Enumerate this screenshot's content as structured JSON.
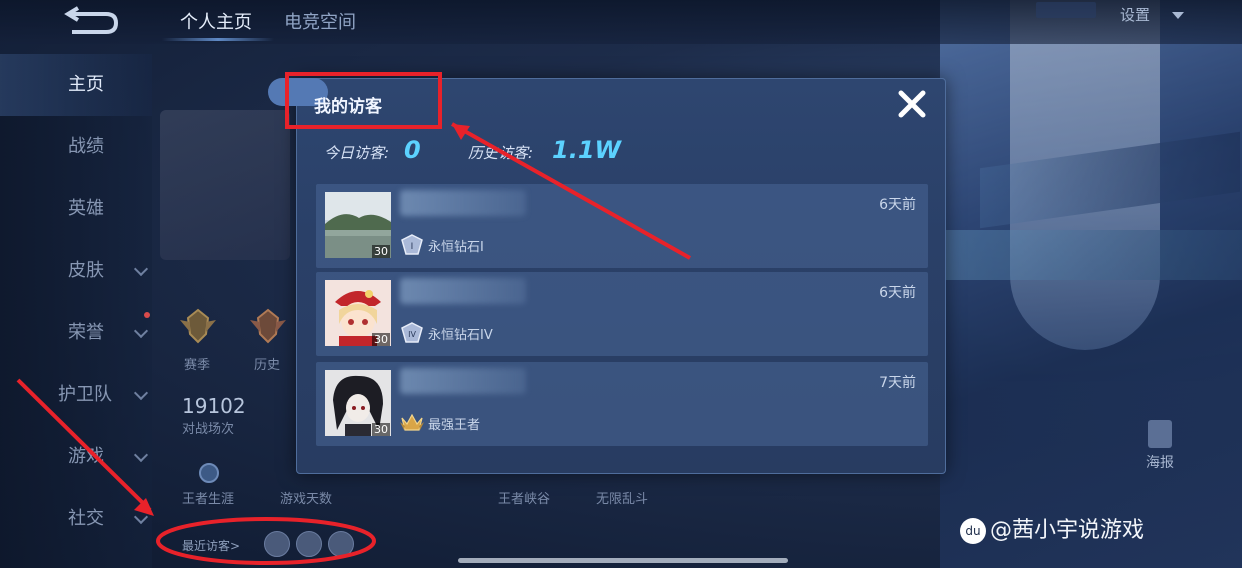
{
  "topbar": {
    "tabs": [
      {
        "label": "个人主页",
        "active": true
      },
      {
        "label": "电竞空间",
        "active": false
      }
    ],
    "settings_label": "设置"
  },
  "sidebar": {
    "items": [
      {
        "label": "主页",
        "active": true,
        "chevron": false
      },
      {
        "label": "战绩",
        "active": false,
        "chevron": false
      },
      {
        "label": "英雄",
        "active": false,
        "chevron": false
      },
      {
        "label": "皮肤",
        "active": false,
        "chevron": true
      },
      {
        "label": "荣誉",
        "active": false,
        "chevron": true
      },
      {
        "label": "护卫队",
        "active": false,
        "chevron": true
      },
      {
        "label": "游戏",
        "active": false,
        "chevron": true
      },
      {
        "label": "社交",
        "active": false,
        "chevron": true
      }
    ]
  },
  "profile": {
    "medal_labels": [
      "赛季",
      "历史"
    ],
    "stats": [
      {
        "value": "19102",
        "label": "对战场次"
      },
      {
        "value": "",
        "label": "王者生涯"
      },
      {
        "value": "",
        "label": "游戏天数"
      },
      {
        "value": "",
        "label": "王者峡谷"
      },
      {
        "value": "",
        "label": "无限乱斗"
      }
    ],
    "recent_visitors_label": "最近访客>"
  },
  "poster_label": "海报",
  "watermark": "@茜小宇说游戏",
  "modal": {
    "title": "我的访客",
    "today_label": "今日访客:",
    "today_value": "0",
    "history_label": "历史访客:",
    "history_value": "1.1W",
    "visitors": [
      {
        "level": "30",
        "rank": "永恒钻石I",
        "rank_numeral": "I",
        "time": "6天前",
        "avatar": "landscape"
      },
      {
        "level": "30",
        "rank": "永恒钻石IV",
        "rank_numeral": "IV",
        "time": "6天前",
        "avatar": "anime-girl-red-hat"
      },
      {
        "level": "30",
        "rank": "最强王者",
        "rank_numeral": "",
        "time": "7天前",
        "avatar": "anime-dark-hair"
      }
    ]
  },
  "colors": {
    "accent_cyan": "#5cd2ff",
    "annotation_red": "#e8222a",
    "modal_bg": "#2a4068"
  }
}
